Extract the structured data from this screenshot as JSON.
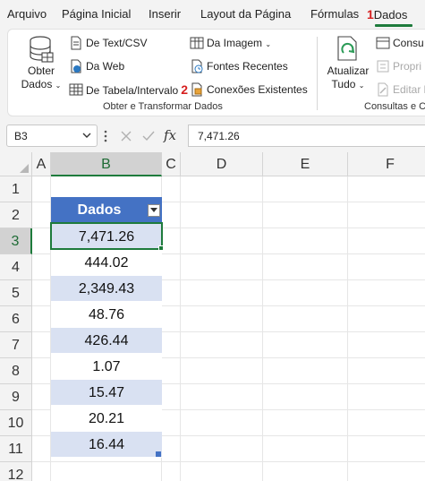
{
  "menu": {
    "tabs": [
      "Arquivo",
      "Página Inicial",
      "Inserir",
      "Layout da Página",
      "Fórmulas"
    ],
    "active_tab": "Dados",
    "active_tab_step": "1"
  },
  "ribbon": {
    "obter_dados": {
      "line1": "Obter",
      "line2": "Dados"
    },
    "de_texto_csv": "De Text/CSV",
    "da_web": "Da Web",
    "de_tabela_intervalo": "De Tabela/Intervalo",
    "de_tabela_step": "2",
    "da_imagem": "Da Imagem",
    "fontes_recentes": "Fontes Recentes",
    "conexoes_existentes": "Conexões Existentes",
    "group_obter": "Obter e Transformar Dados",
    "atualizar": {
      "line1": "Atualizar",
      "line2": "Tudo"
    },
    "consultas": "Consu",
    "propriedades": "Propri",
    "editar_links": "Editar l",
    "group_consultas": "Consultas e C"
  },
  "formula_bar": {
    "name_box": "B3",
    "formula_value": "7,471.26",
    "fx_label": "fx"
  },
  "grid": {
    "columns": [
      "A",
      "B",
      "C",
      "D",
      "E",
      "F"
    ],
    "rows": [
      "1",
      "2",
      "3",
      "4",
      "5",
      "6",
      "7",
      "8",
      "9",
      "10",
      "11",
      "12"
    ],
    "selected_column": "B",
    "selected_row": "3",
    "table_header": "Dados",
    "values": [
      "7,471.26",
      "444.02",
      "2,349.43",
      "48.76",
      "426.44",
      "1.07",
      "15.47",
      "20.21",
      "16.44"
    ]
  },
  "colors": {
    "accent_green": "#1e7b3c",
    "table_header_blue": "#4472c4",
    "table_band": "#d9e1f2",
    "step_red": "#d62020"
  }
}
